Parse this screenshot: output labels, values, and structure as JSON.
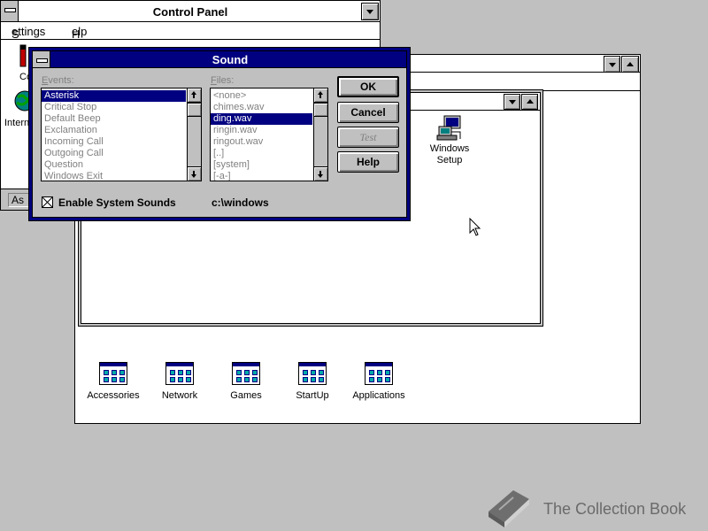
{
  "control_panel": {
    "title": "Control Panel",
    "menu": [
      "Settings",
      "Help"
    ],
    "icon_labels": [
      "Co",
      "Intern"
    ],
    "status_text": "As"
  },
  "program_manager": {
    "groups": [
      {
        "label": "Accessories"
      },
      {
        "label": "Network"
      },
      {
        "label": "Games"
      },
      {
        "label": "StartUp"
      },
      {
        "label": "Applications"
      }
    ],
    "main_window": {
      "icons": [
        {
          "label_line1": "Windows",
          "label_line2": "Setup"
        }
      ]
    }
  },
  "sound_dialog": {
    "title": "Sound",
    "events_label": "Events:",
    "files_label": "Files:",
    "events": [
      {
        "text": "Asterisk",
        "selected": true
      },
      {
        "text": "Critical Stop",
        "selected": false
      },
      {
        "text": "Default Beep",
        "selected": false
      },
      {
        "text": "Exclamation",
        "selected": false
      },
      {
        "text": "Incoming Call",
        "selected": false
      },
      {
        "text": "Outgoing Call",
        "selected": false
      },
      {
        "text": "Question",
        "selected": false
      },
      {
        "text": "Windows Exit",
        "selected": false
      }
    ],
    "files": [
      {
        "text": "<none>",
        "selected": false
      },
      {
        "text": "chimes.wav",
        "selected": false
      },
      {
        "text": "ding.wav",
        "selected": true
      },
      {
        "text": "ringin.wav",
        "selected": false
      },
      {
        "text": "ringout.wav",
        "selected": false
      },
      {
        "text": "[..]",
        "selected": false
      },
      {
        "text": "[system]",
        "selected": false
      },
      {
        "text": "[-a-]",
        "selected": false
      }
    ],
    "buttons": {
      "ok": "OK",
      "cancel": "Cancel",
      "test": "Test",
      "help": "Help"
    },
    "checkbox_label": "Enable System Sounds",
    "checkbox_checked": true,
    "path": "c:\\windows"
  },
  "watermark": {
    "text": "The Collection Book"
  },
  "colors": {
    "desktop": "#c0c0c0",
    "active_title": "#000080",
    "disabled_text": "#808080"
  }
}
